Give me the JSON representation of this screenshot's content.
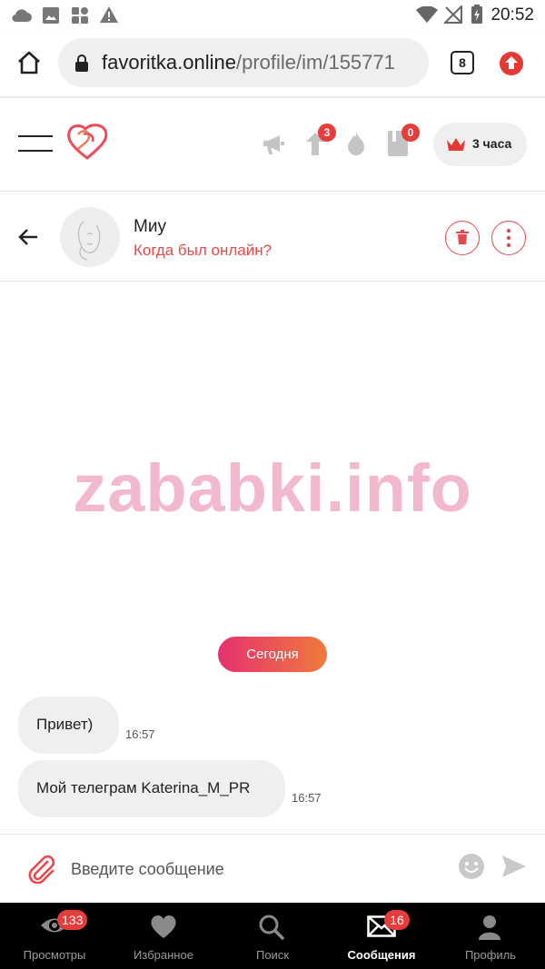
{
  "status_bar": {
    "time": "20:52",
    "icons": [
      "cloud-icon",
      "image-icon",
      "apps-icon",
      "warning-icon",
      "wifi-icon",
      "no-signal-icon",
      "battery-icon"
    ]
  },
  "browser": {
    "url_domain": "favoritka.online",
    "url_path": "/profile/im/155771",
    "tab_count": "8"
  },
  "site_header": {
    "raise_badge": "3",
    "notes_badge": "0",
    "premium_label": "3 часа"
  },
  "chat": {
    "contact_name": "Миу",
    "contact_status": "Когда был онлайн?",
    "watermark": "zababki.info",
    "date_separator": "Сегодня",
    "messages": [
      {
        "text": "Привет)",
        "time": "16:57"
      },
      {
        "text": "Мой телеграм Katerina_M_PR",
        "time": "16:57"
      }
    ]
  },
  "composer": {
    "placeholder": "Введите сообщение"
  },
  "bottom_nav": {
    "items": [
      {
        "label": "Просмотры",
        "badge": "133"
      },
      {
        "label": "Избранное"
      },
      {
        "label": "Поиск"
      },
      {
        "label": "Сообщения",
        "badge": "16"
      },
      {
        "label": "Профиль"
      }
    ]
  },
  "colors": {
    "accent": "#e8474c",
    "date_pill_start": "#e53170",
    "date_pill_end": "#f07a3c",
    "badge": "#e53c3c",
    "watermark": "#f2b8cf"
  }
}
